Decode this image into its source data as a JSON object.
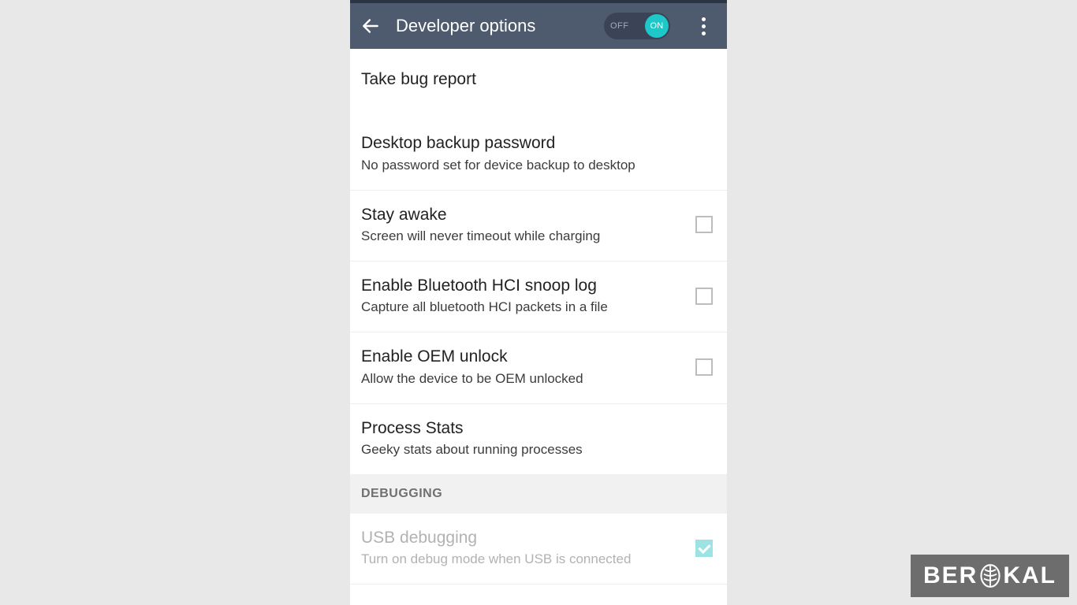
{
  "header": {
    "title": "Developer options",
    "toggle_off": "OFF",
    "toggle_on": "ON",
    "toggle_state": true
  },
  "items": [
    {
      "title": "Take bug report",
      "sub": "",
      "checkbox": false,
      "checked": false
    },
    {
      "title": "Desktop backup password",
      "sub": "No password set for device backup to desktop",
      "checkbox": false,
      "checked": false
    },
    {
      "title": "Stay awake",
      "sub": "Screen will never timeout while charging",
      "checkbox": true,
      "checked": false
    },
    {
      "title": "Enable Bluetooth HCI snoop log",
      "sub": "Capture all bluetooth HCI packets in a file",
      "checkbox": true,
      "checked": false
    },
    {
      "title": "Enable OEM unlock",
      "sub": "Allow the device to be OEM unlocked",
      "checkbox": true,
      "checked": false
    },
    {
      "title": "Process Stats",
      "sub": "Geeky stats about running processes",
      "checkbox": false,
      "checked": false
    }
  ],
  "section": {
    "label": "DEBUGGING"
  },
  "debug_items": [
    {
      "title": "USB debugging",
      "sub": "Turn on debug mode when USB is connected",
      "checkbox": true,
      "checked": true,
      "disabled": true
    }
  ],
  "watermark": {
    "pre": "BER",
    "post": "KAL"
  }
}
